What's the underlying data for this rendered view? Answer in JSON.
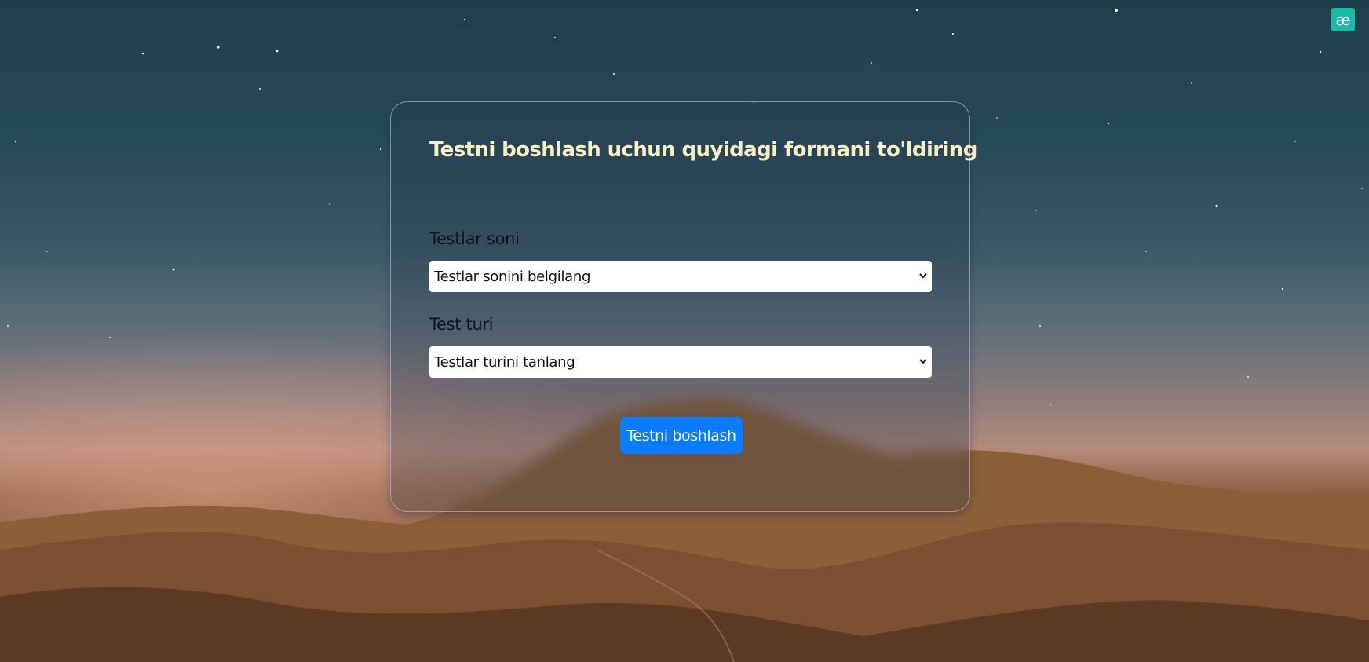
{
  "logo": {
    "glyph": "æ",
    "icon": "ae-logo-icon"
  },
  "form": {
    "title": "Testni boshlash uchun quyidagi formani to'ldiring",
    "count_field": {
      "label": "Testlar soni",
      "selected": "Testlar sonini belgilang"
    },
    "type_field": {
      "label": "Test turi",
      "selected": "Testlar turini tanlang"
    },
    "submit_label": "Testni boshlash"
  },
  "colors": {
    "accent": "#0a7cff",
    "title": "#f6f1c4",
    "logo_bg": "#19b9a6"
  }
}
